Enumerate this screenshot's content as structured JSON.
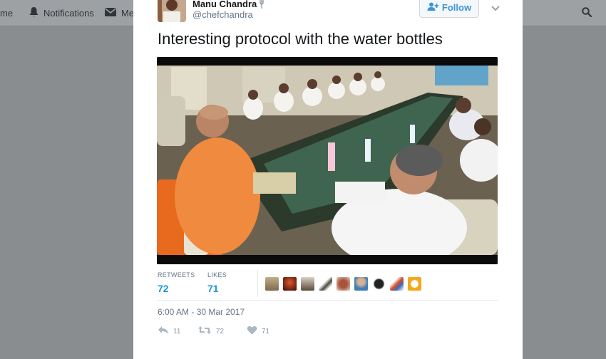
{
  "nav": {
    "home_label": "me",
    "notifications_label": "Notifications",
    "messages_label": "Mes"
  },
  "tweet": {
    "display_name": "Manu Chandra",
    "handle": "@chefchandra",
    "follow_label": "Follow",
    "text": "Interesting protocol with the water bottles",
    "stats": {
      "retweets_label": "RETWEETS",
      "retweets_value": "72",
      "likes_label": "LIKES",
      "likes_value": "71"
    },
    "timestamp": "6:00 AM - 30 Mar 2017",
    "actions": {
      "reply_count": "11",
      "retweet_count": "72",
      "like_count": "71"
    }
  },
  "colors": {
    "accent": "#1b95e0",
    "overlay": "#8a8d90",
    "muted_text": "#657786"
  },
  "icons": [
    "home-icon",
    "notifications-icon",
    "messages-icon",
    "search-icon",
    "add-user-icon",
    "chevron-down-icon",
    "reply-icon",
    "retweet-icon",
    "heart-icon"
  ]
}
